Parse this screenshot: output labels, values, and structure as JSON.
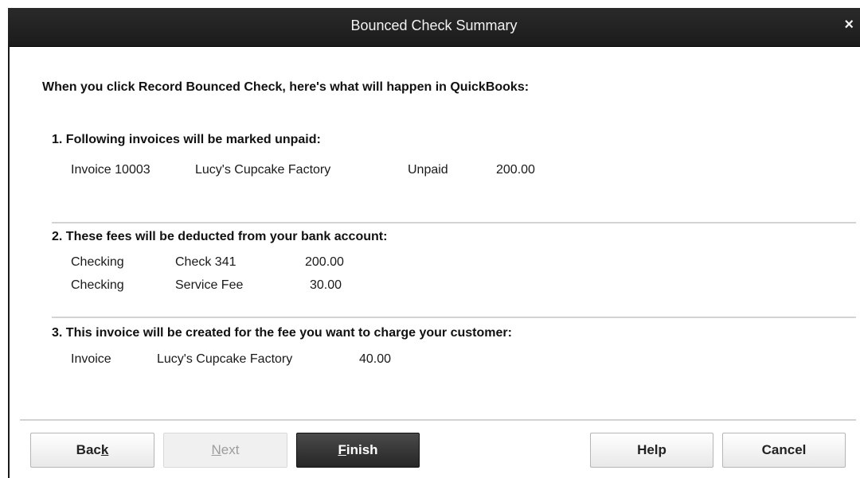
{
  "window": {
    "title": "Bounced Check Summary",
    "close_glyph": "×"
  },
  "heading": "When you click Record Bounced Check, here's what will happen in QuickBooks:",
  "section1": {
    "title": "1. Following invoices will be marked unpaid:",
    "rows": [
      {
        "invoice": "Invoice 10003",
        "customer": "Lucy's Cupcake Factory",
        "status": "Unpaid",
        "amount": "200.00"
      }
    ]
  },
  "section2": {
    "title": "2. These fees will be deducted from your bank account:",
    "rows": [
      {
        "account": "Checking",
        "item": "Check 341",
        "amount": "200.00"
      },
      {
        "account": "Checking",
        "item": "Service Fee",
        "amount": "30.00"
      }
    ]
  },
  "section3": {
    "title": "3. This invoice will be created for the fee you want to charge your customer:",
    "rows": [
      {
        "type": "Invoice",
        "customer": "Lucy's Cupcake Factory",
        "amount": "40.00"
      }
    ]
  },
  "buttons": {
    "back": {
      "pre": "Bac",
      "key": "k",
      "post": ""
    },
    "next": {
      "pre": "",
      "key": "N",
      "post": "ext"
    },
    "finish": {
      "pre": "",
      "key": "F",
      "post": "inish"
    },
    "help": "Help",
    "cancel": "Cancel"
  }
}
